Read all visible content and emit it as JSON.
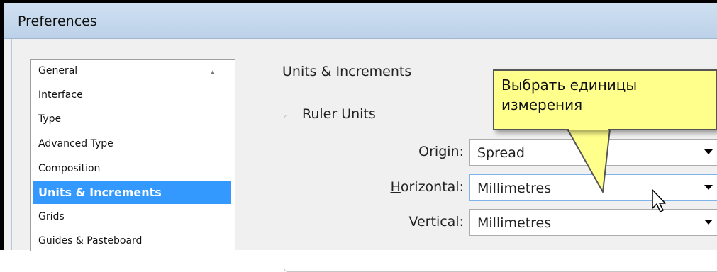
{
  "window": {
    "title": "Preferences"
  },
  "categories": [
    {
      "label": "General",
      "selected": false
    },
    {
      "label": "Interface",
      "selected": false
    },
    {
      "label": "Type",
      "selected": false
    },
    {
      "label": "Advanced Type",
      "selected": false
    },
    {
      "label": "Composition",
      "selected": false
    },
    {
      "label": "Units & Increments",
      "selected": true
    },
    {
      "label": "Grids",
      "selected": false
    },
    {
      "label": "Guides & Pasteboard",
      "selected": false
    }
  ],
  "panel": {
    "title": "Units & Increments",
    "ruler_units": {
      "legend": "Ruler Units",
      "origin": {
        "label_pre": "",
        "label_ul": "O",
        "label_post": "rigin:",
        "value": "Spread"
      },
      "horizontal": {
        "label_pre": "",
        "label_ul": "H",
        "label_post": "orizontal:",
        "value": "Millimetres"
      },
      "vertical": {
        "label_pre": "Ver",
        "label_ul": "t",
        "label_post": "ical:",
        "value": "Millimetres"
      }
    }
  },
  "callout": {
    "text": "Выбрать единицы измерения"
  },
  "colors": {
    "selection": "#3399ff",
    "callout_bg": "#ffff8c",
    "titlebar": "#c6d9ee"
  },
  "icons": {
    "scroll_up": "triangle-up",
    "dropdown": "triangle-down",
    "cursor": "arrow-pointer"
  }
}
